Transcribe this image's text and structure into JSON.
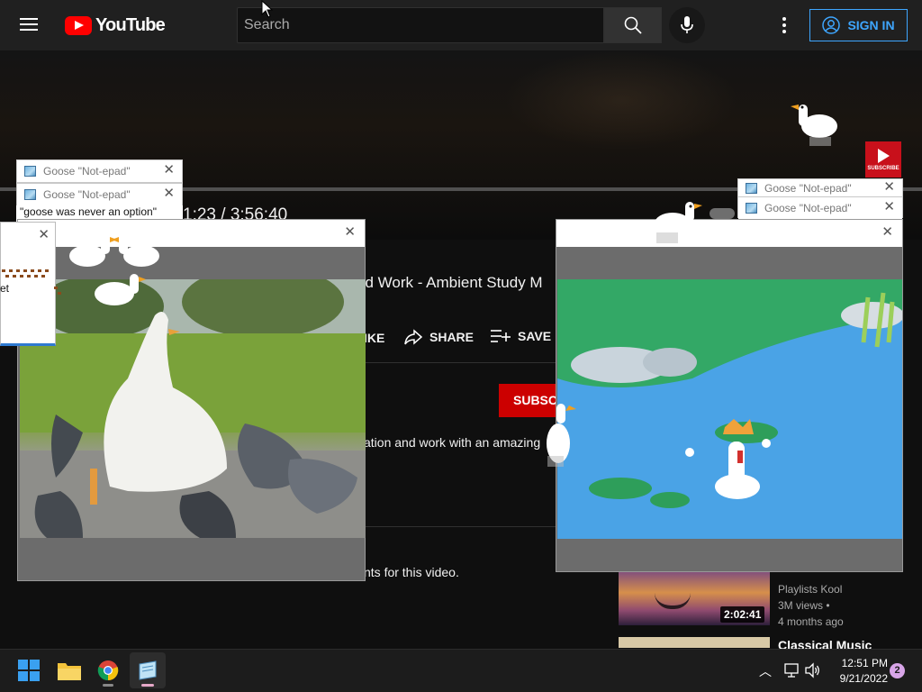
{
  "header": {
    "brand": "YouTube",
    "search_placeholder": "Search",
    "sign_in_label": "SIGN IN"
  },
  "player": {
    "time_display": "1:23 / 3:56:40",
    "subscribe_badge_text": "SUBSCRIBE"
  },
  "video": {
    "title_fragment": "nd Work - Ambient Study M",
    "like_label": "IKE",
    "share_label": "SHARE",
    "save_label": "SAVE",
    "subscribe_label": "SUBSCRIBE",
    "description_fragment": "ation and work with an amazing",
    "comments_notice": "nts for this video."
  },
  "sidebar": {
    "items": [
      {
        "channel": "Playlists Kool",
        "views": "3M views •",
        "age": "4 months ago",
        "duration": "2:02:41"
      },
      {
        "title": "Classical Music"
      }
    ]
  },
  "popups": {
    "notepad_title": "Goose \"Not-epad\"",
    "notepad_body": "\"goose was never an option\"",
    "mini_window_text": "et"
  },
  "taskbar": {
    "time": "12:51 PM",
    "date": "9/21/2022",
    "notifications": "2"
  },
  "colors": {
    "yt_red": "#ff0000",
    "subscribe_red": "#cc0000",
    "link_blue": "#3ea6ff",
    "background": "#0f0f0f"
  }
}
